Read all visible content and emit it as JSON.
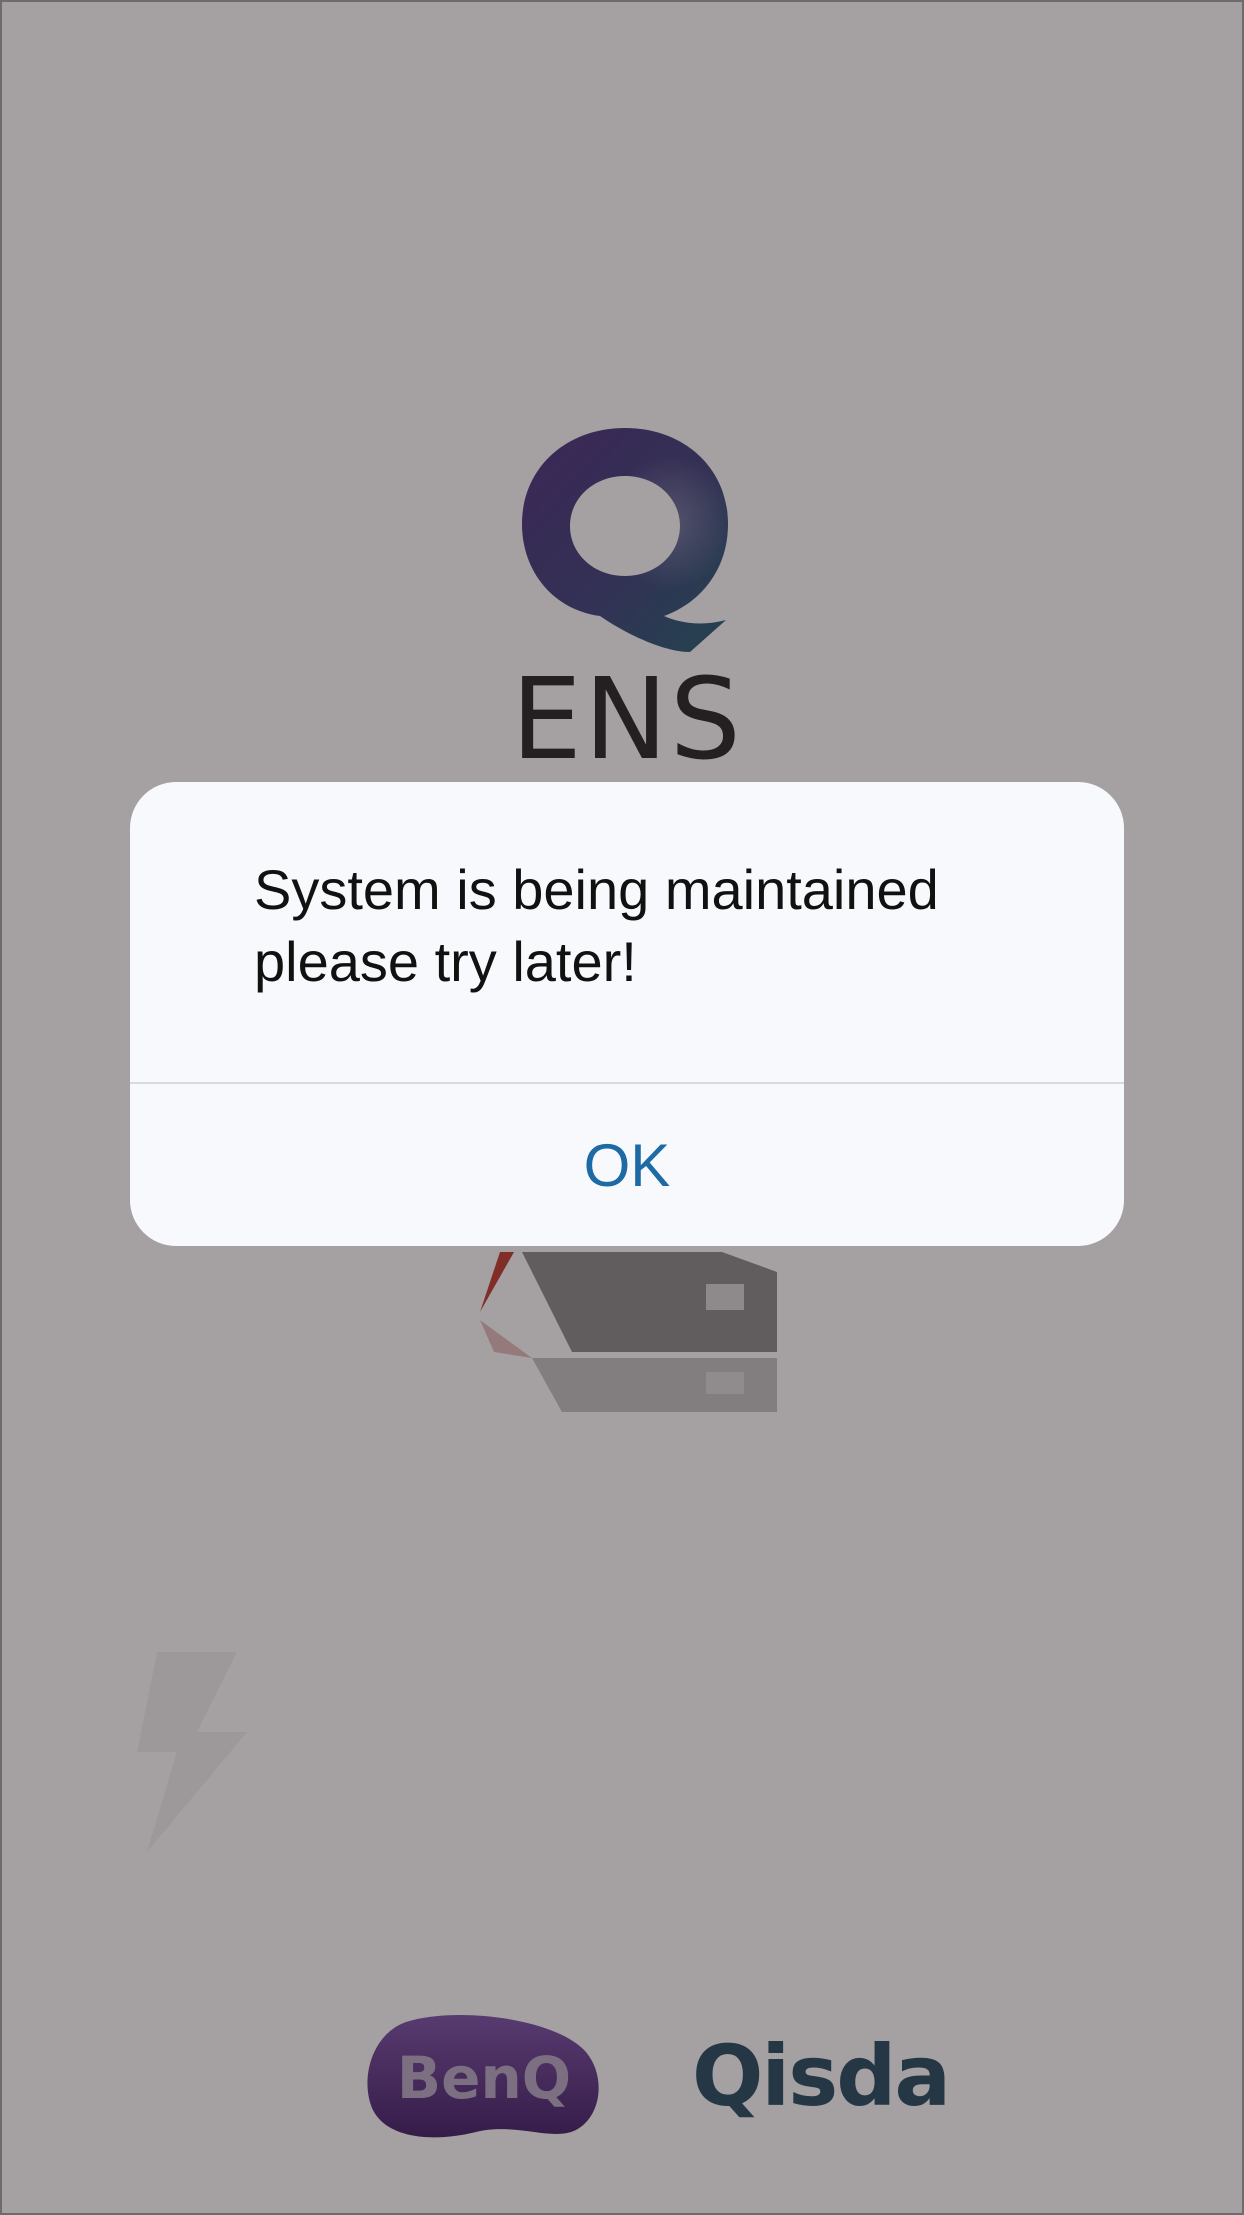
{
  "splash": {
    "app_logo_letter": "Q",
    "app_name": "ENS",
    "partner_logo_benq": "BenQ",
    "partner_logo_qisda": "Qisda"
  },
  "alert": {
    "message_line1": "System is being maintained",
    "message_line2": "please try later!",
    "ok_label": "OK"
  },
  "colors": {
    "overlay": "#a29e9f",
    "dialog_background": "#f7f9fc",
    "ok_text": "#1d6aa5",
    "ens_text": "#221f1f",
    "benq_purple": "#5a2d82",
    "qisda_blue": "#24495f"
  }
}
